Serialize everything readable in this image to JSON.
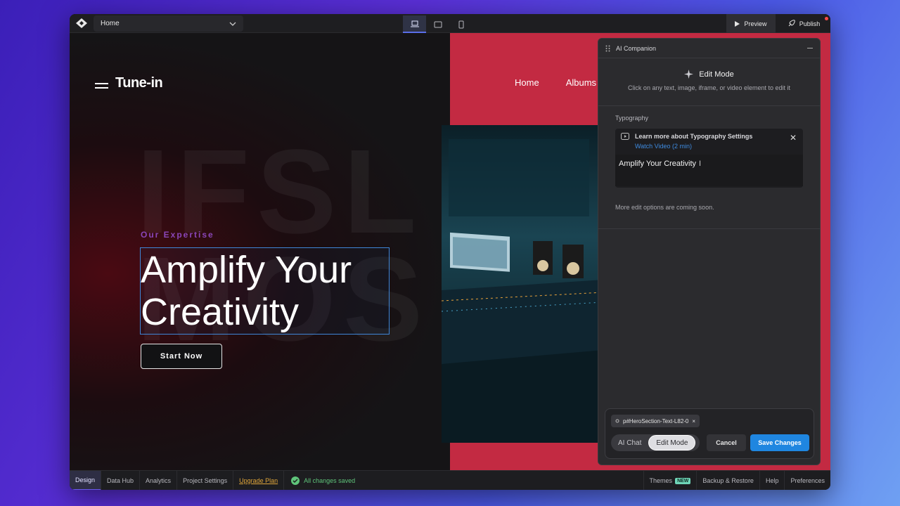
{
  "topbar": {
    "page_select": "Home",
    "preview_label": "Preview",
    "publish_label": "Publish"
  },
  "site": {
    "brand": "Tune-in",
    "nav": [
      "Home",
      "Albums"
    ],
    "eyebrow": "Our Expertise",
    "headline_line1": "Amplify Your",
    "headline_line2": "Creativity",
    "cta": "Start Now"
  },
  "panel": {
    "title": "AI Companion",
    "mode_title": "Edit Mode",
    "mode_subtitle": "Click on any text, image, iframe, or video element to edit it",
    "section_label": "Typography",
    "learn_title": "Learn more about Typography Settings",
    "learn_link": "Watch Video (2 min)",
    "text_value": "Amplify Your Creativity",
    "more_options": "More edit options are coming soon.",
    "chip_label": "p#HeroSection-Text-L82-0",
    "mode_ai_chat": "AI Chat",
    "mode_edit": "Edit Mode",
    "cancel_label": "Cancel",
    "save_label": "Save Changes"
  },
  "statusbar": {
    "tabs": [
      "Design",
      "Data Hub",
      "Analytics",
      "Project Settings"
    ],
    "upgrade": "Upgrade Plan",
    "saved": "All changes saved",
    "right": {
      "themes": "Themes",
      "new_badge": "NEW",
      "backup": "Backup & Restore",
      "help": "Help",
      "preferences": "Preferences"
    }
  },
  "colors": {
    "accent_blue": "#1f86e0",
    "hero_red": "#c32a42",
    "eyebrow_purple": "#8a46b8",
    "saved_green": "#5fc47a",
    "upgrade_orange": "#e0a63a"
  }
}
